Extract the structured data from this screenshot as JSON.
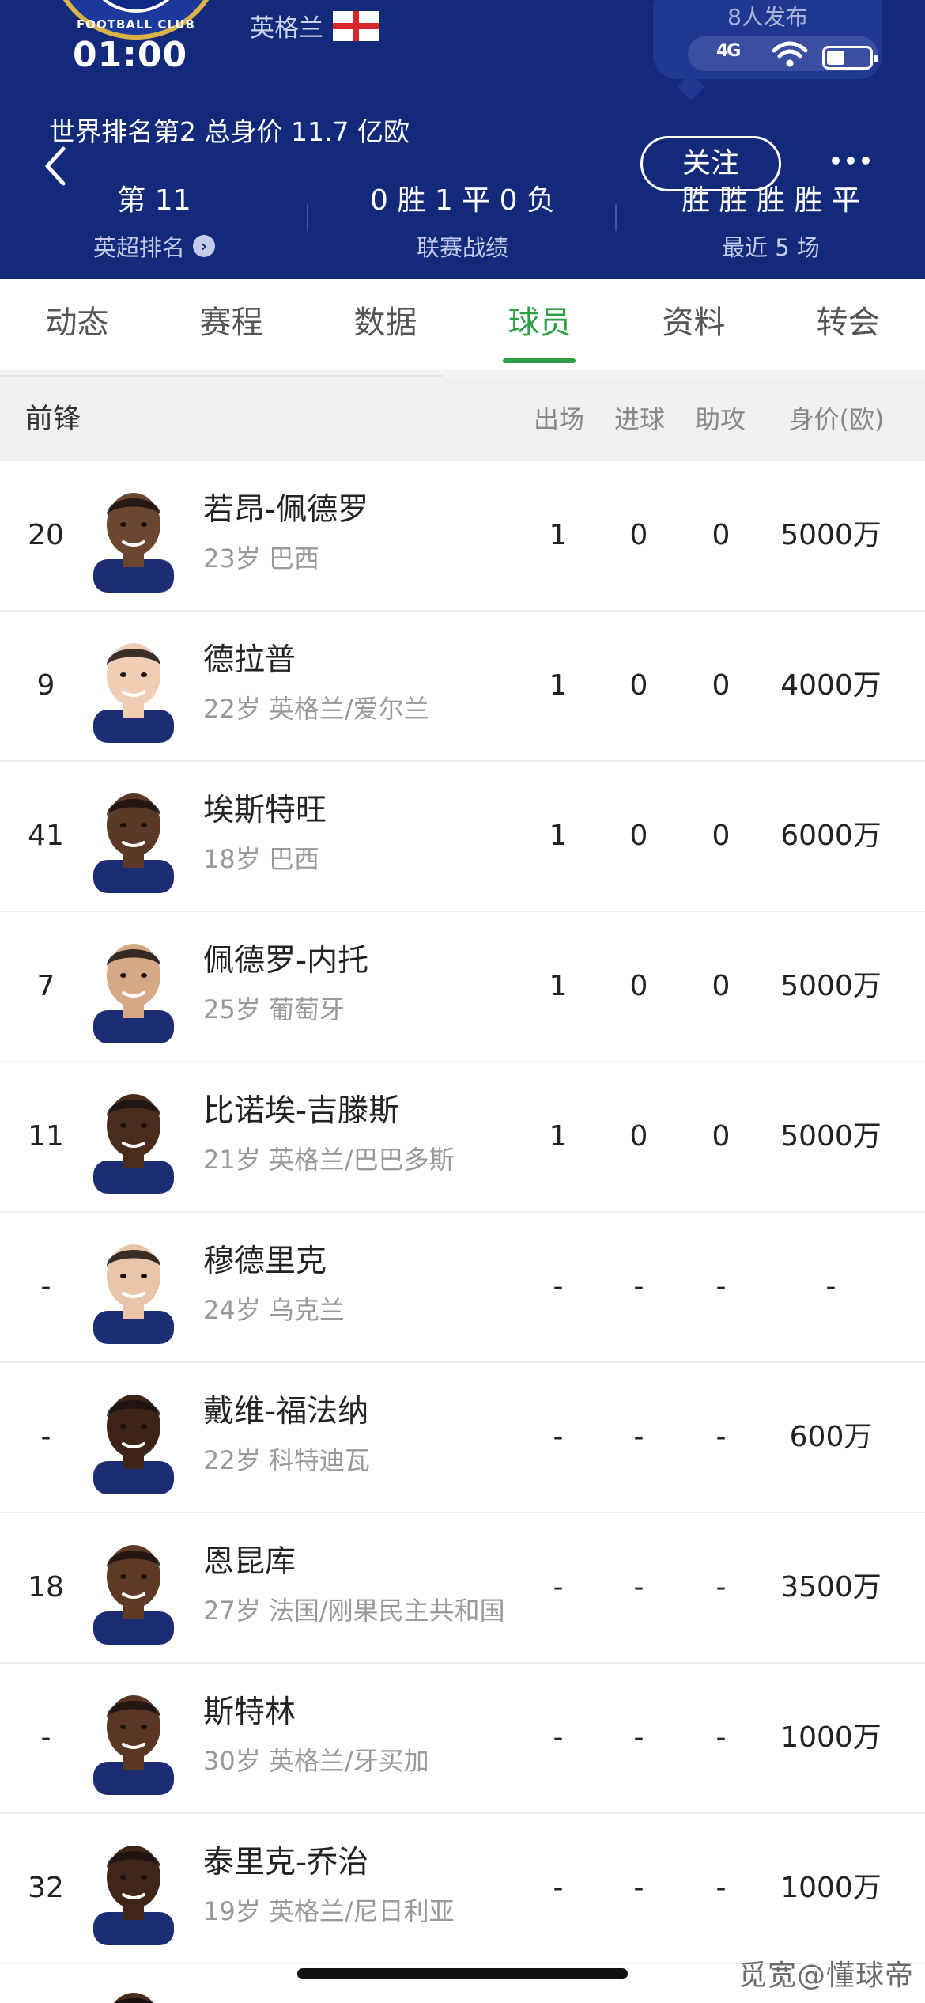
{
  "status": {
    "time": "01:00",
    "signal_label": "4G",
    "publishers": "8人发布"
  },
  "team": {
    "crest_text": "FOOTBALL CLUB",
    "country": "英格兰",
    "ranking_line": "世界排名第2  总身价 11.7 亿欧",
    "follow_label": "关注"
  },
  "stats": [
    {
      "value": "第 11",
      "label": "英超排名"
    },
    {
      "value": "0 胜  1 平  0 负",
      "label": "联赛战绩"
    },
    {
      "value": "胜 胜 胜 胜 平",
      "label": "最近 5 场"
    }
  ],
  "tabs": [
    "动态",
    "赛程",
    "数据",
    "球员",
    "资料",
    "转会"
  ],
  "active_tab_index": 3,
  "section": {
    "title": "前锋",
    "columns": [
      "出场",
      "进球",
      "助攻",
      "身价(欧)"
    ]
  },
  "players": [
    {
      "number": "20",
      "name": "若昂-佩德罗",
      "info": "23岁 巴西",
      "apps": "1",
      "goals": "0",
      "assists": "0",
      "value": "5000万",
      "skin": "#6b4630"
    },
    {
      "number": "9",
      "name": "德拉普",
      "info": "22岁 英格兰/爱尔兰",
      "apps": "1",
      "goals": "0",
      "assists": "0",
      "value": "4000万",
      "skin": "#f0cdb3"
    },
    {
      "number": "41",
      "name": "埃斯特旺",
      "info": "18岁 巴西",
      "apps": "1",
      "goals": "0",
      "assists": "0",
      "value": "6000万",
      "skin": "#5a3a26"
    },
    {
      "number": "7",
      "name": "佩德罗-内托",
      "info": "25岁 葡萄牙",
      "apps": "1",
      "goals": "0",
      "assists": "0",
      "value": "5000万",
      "skin": "#d6a886"
    },
    {
      "number": "11",
      "name": "比诺埃-吉滕斯",
      "info": "21岁 英格兰/巴巴多斯",
      "apps": "1",
      "goals": "0",
      "assists": "0",
      "value": "5000万",
      "skin": "#4a2c1d"
    },
    {
      "number": "-",
      "name": "穆德里克",
      "info": "24岁 乌克兰",
      "apps": "-",
      "goals": "-",
      "assists": "-",
      "value": "-",
      "skin": "#e9c4a8"
    },
    {
      "number": "-",
      "name": "戴维-福法纳",
      "info": "22岁 科特迪瓦",
      "apps": "-",
      "goals": "-",
      "assists": "-",
      "value": "600万",
      "skin": "#3d2416"
    },
    {
      "number": "18",
      "name": "恩昆库",
      "info": "27岁 法国/刚果民主共和国",
      "apps": "-",
      "goals": "-",
      "assists": "-",
      "value": "3500万",
      "skin": "#5e3a25"
    },
    {
      "number": "-",
      "name": "斯特林",
      "info": "30岁 英格兰/牙买加",
      "apps": "-",
      "goals": "-",
      "assists": "-",
      "value": "1000万",
      "skin": "#5a3724"
    },
    {
      "number": "32",
      "name": "泰里克-乔治",
      "info": "19岁 英格兰/尼日利亚",
      "apps": "-",
      "goals": "-",
      "assists": "-",
      "value": "1000万",
      "skin": "#3f2618"
    }
  ],
  "watermark": "觅宽@懂球帝"
}
